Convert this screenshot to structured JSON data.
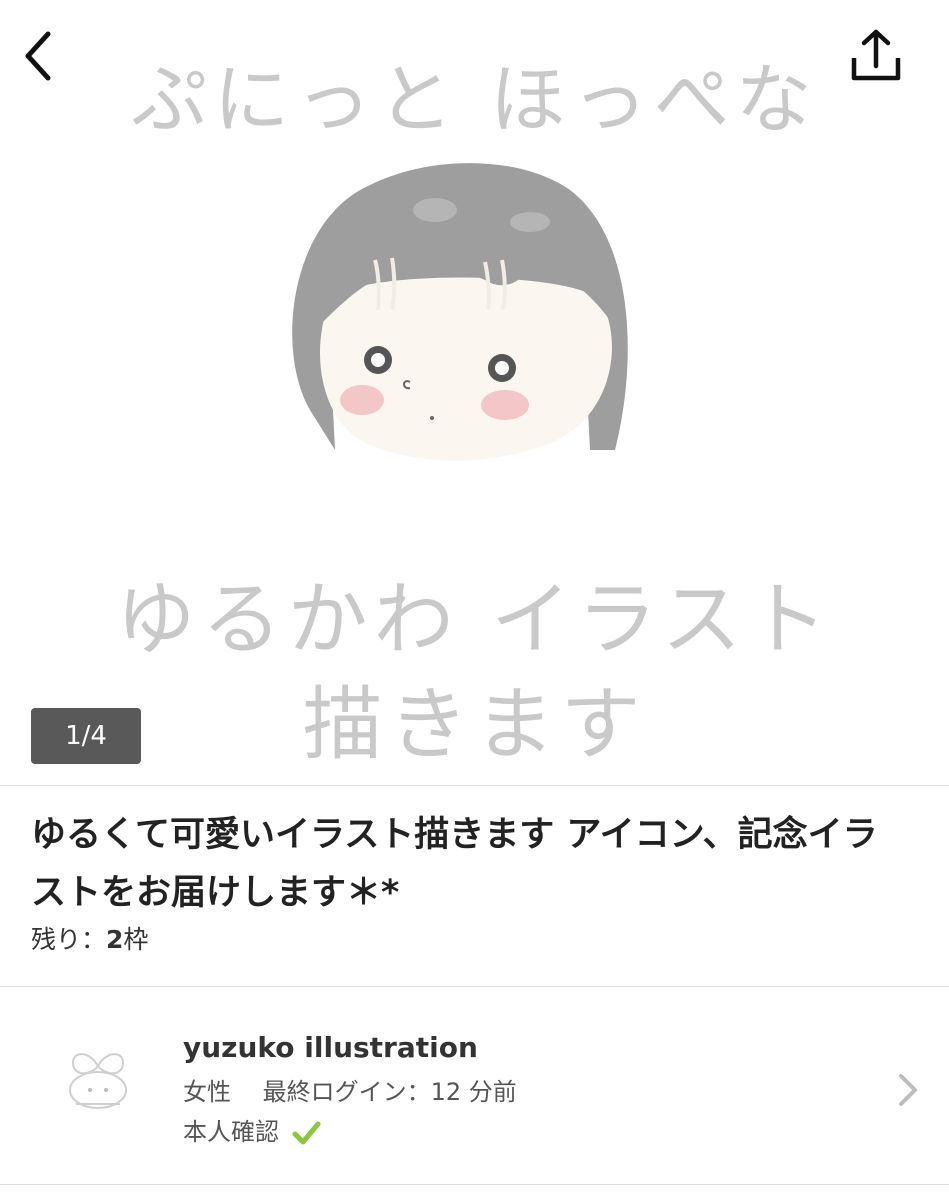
{
  "hero": {
    "title": "ぷにっと ほっぺな",
    "line1": "ゆるかわ イラスト",
    "line2": "描きます"
  },
  "carousel": {
    "counter": "1/4"
  },
  "listing": {
    "title": "ゆるくて可愛いイラスト描きます アイコン、記念イラストをお届けします＊*",
    "remaining_label": "残り：",
    "remaining_value": "2",
    "remaining_unit": "枠"
  },
  "seller": {
    "name": "yuzuko illustration",
    "meta": "女性　 最終ログイン：12 分前",
    "verified_label": "本人確認"
  },
  "icons": {
    "back": "chevron-left-icon",
    "share": "share-icon",
    "verified": "check-icon",
    "navigate": "chevron-right-icon"
  },
  "colors": {
    "counter_bg": "#595959",
    "verified_check": "#8cc63f",
    "hero_text": "#c9c9c9"
  }
}
